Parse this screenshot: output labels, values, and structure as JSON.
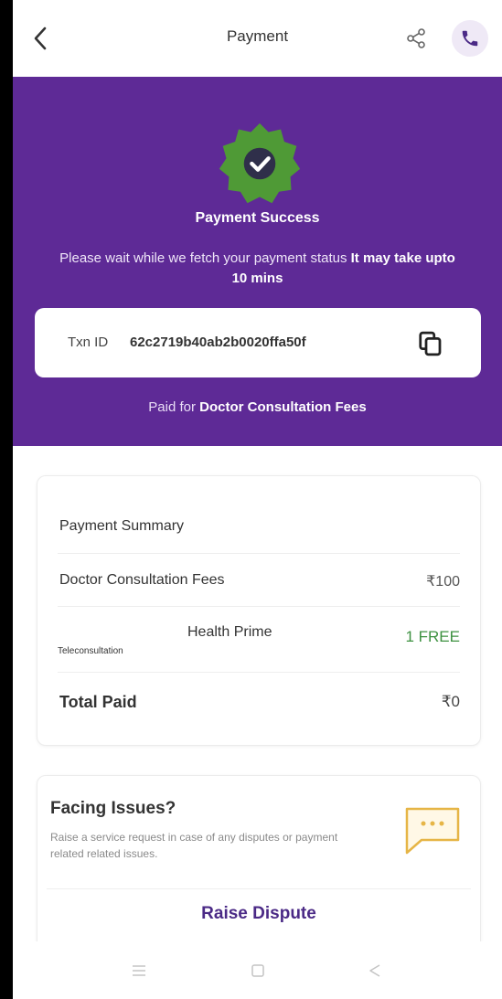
{
  "header": {
    "title": "Payment",
    "back_icon": "chevron-left-icon",
    "share_icon": "share-icon",
    "call_icon": "phone-icon"
  },
  "banner": {
    "status_title": "Payment Success",
    "message_prefix": "Please wait while we fetch your payment status",
    "message_bold": "It may take upto 10 mins",
    "txn_label": "Txn ID",
    "txn_id": "62c2719b40ab2b0020ffa50f",
    "paid_for_prefix": "Paid for",
    "paid_for_item": "Doctor Consultation Fees",
    "colors": {
      "banner": "#5e2a96",
      "badge": "#4f9a36"
    }
  },
  "summary": {
    "title": "Payment Summary",
    "fee_label": "Doctor Consultation Fees",
    "fee_amount": "₹100",
    "teleconsult_label": "Teleconsultation",
    "prime_label": "Health Prime",
    "prime_amount": "1 FREE",
    "total_label": "Total Paid",
    "total_amount": "₹0"
  },
  "issues": {
    "title": "Facing Issues?",
    "description": "Raise a service request in case of any disputes or payment related related issues.",
    "button": "Raise Dispute"
  },
  "navbar": {
    "items": [
      "menu-icon",
      "home-icon",
      "back-triangle-icon"
    ]
  }
}
